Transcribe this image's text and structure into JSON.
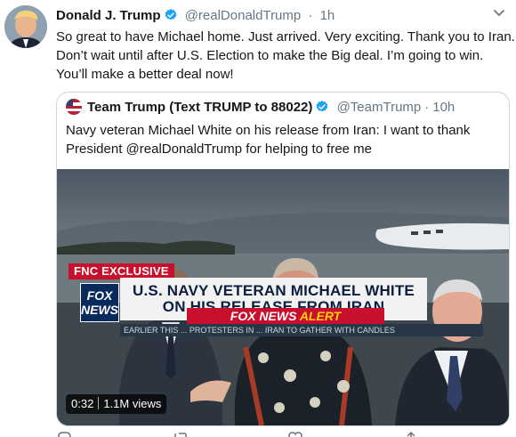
{
  "tweet": {
    "author_name": "Donald J. Trump",
    "handle": "@realDonaldTrump",
    "separator": "·",
    "time": "1h",
    "text_lines": [
      "So great to have Michael home. Just arrived. Very exciting. Thank you to Iran.",
      "Don’t wait until after U.S. Election to make the Big deal. I’m going to win.",
      "You’ll make a better deal now!"
    ],
    "verified_icon": "verified-badge-icon",
    "more_icon": "chevron-down-icon"
  },
  "quoted": {
    "author_name": "Team Trump (Text TRUMP to 88022)",
    "handle": "@TeamTrump",
    "separator": "·",
    "time": "10h",
    "text_lines": [
      "Navy veteran Michael White on his release from Iran: I want to thank",
      "President @realDonaldTrump for helping to free me"
    ],
    "video": {
      "tag": "FNC EXCLUSIVE",
      "chyron_line1": "U.S. NAVY VETERAN MICHAEL WHITE",
      "chyron_line2": "ON HIS RELEASE FROM IRAN",
      "alert_prefix": "FOX NEWS",
      "alert_word": "ALERT",
      "logo_line1": "FOX",
      "logo_line2": "NEWS",
      "ticker": "EARLIER THIS ... PROTESTERS IN ... IRAN TO GATHER WITH CANDLES",
      "duration": "0:32",
      "views": "1.1M views"
    }
  },
  "actions": {
    "reply_icon": "reply-icon",
    "retweet_icon": "retweet-icon",
    "like_icon": "heart-icon",
    "share_icon": "share-icon"
  },
  "colors": {
    "verified": "#1da1f2",
    "muted": "#657786",
    "border": "#ccd6dd",
    "fox_red": "#c8102e",
    "fox_navy": "#0a2a5e"
  }
}
